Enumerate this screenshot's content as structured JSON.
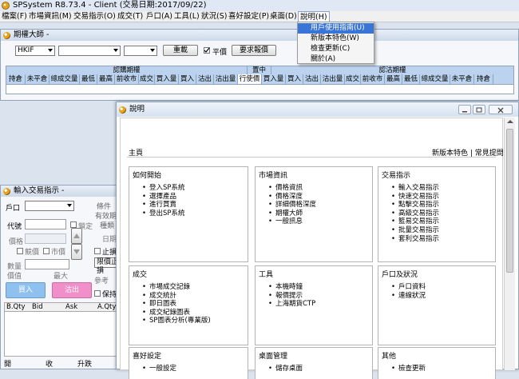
{
  "app": {
    "title": "SPSystem R8.73.4 - Client (交易日期:2017/09/22)"
  },
  "menubar": {
    "items": [
      "檔案(F)",
      "市場資訊(M)",
      "交易指示(O)",
      "成交(T)",
      "戶口(A)",
      "工具(L)",
      "狀況(S)",
      "喜好設定(P)",
      "桌面(D)",
      "說明(H)"
    ]
  },
  "help_menu": {
    "items": [
      "用戶使用指南(U)",
      "新版本特色(W)",
      "檢查更新(C)",
      "關於(A)"
    ],
    "highlighted_index": 0
  },
  "options_window": {
    "title": "期權大師 -",
    "product": "HKIF",
    "combo2": "",
    "combo3": "",
    "reload_label": "重載",
    "parity_label": "平價",
    "parity_checked": true,
    "request_quote_label": "要求報價",
    "group_calls": "認購期權",
    "group_strike": "置中",
    "group_puts": "認沽期權",
    "columns": [
      "持倉",
      "未平倉",
      "總成交量",
      "最低",
      "最高",
      "前收市",
      "成交",
      "買入量",
      "買入",
      "沽出",
      "沽出量",
      "行使價",
      "買入量",
      "買入",
      "沽出",
      "沽出量",
      "成交",
      "前收市",
      "最高",
      "最低",
      "總成交量",
      "未平倉",
      "持倉"
    ]
  },
  "order_window": {
    "title": "輸入交易指示 -",
    "account_label": "戶口",
    "code_label": "代號",
    "lock_label": "鎖定",
    "price_label": "價格",
    "ao_label": "競價",
    "market_label": "市價",
    "qty_label": "數量",
    "value_label": "價值",
    "max_label": "最大",
    "condition_label": "條件",
    "validity_label": "有效期",
    "type_label": "種類",
    "date_label": "日期",
    "stop_label": "止損",
    "limit_label": "限價止損",
    "ref_label": "參考",
    "keep_label": "保持",
    "buy_label": "買入",
    "sell_label": "沽出",
    "grid_headers": [
      "B.Qty",
      "Bid",
      "Ask",
      "A.Qty"
    ],
    "bottom_labels": [
      "開",
      "收",
      "升跌"
    ]
  },
  "help_window": {
    "title": "說明",
    "home_label": "主頁",
    "links": "新版本特色 | 常見提問",
    "sections": [
      {
        "title": "如何開始",
        "items": [
          "登入SP系統",
          "選擇產品",
          "進行買賣",
          "登出SP系統"
        ]
      },
      {
        "title": "市場資訊",
        "items": [
          "價格資訊",
          "價格深度",
          "詳細價格深度",
          "期權大師",
          "一般訊息"
        ]
      },
      {
        "title": "交易指示",
        "items": [
          "輸入交易指示",
          "快速交易指示",
          "點擊交易指示",
          "高級交易指示",
          "籃易交易指示",
          "批量交易指示",
          "套利交易指示"
        ]
      },
      {
        "title": "成交",
        "items": [
          "市場成交記錄",
          "成交統計",
          "即日圖表",
          "成交紀錄圖表",
          "SP圖表分析(專業版)"
        ]
      },
      {
        "title": "工具",
        "items": [
          "本機時鐘",
          "報價提示",
          "上海期貨CTP"
        ]
      },
      {
        "title": "戶口及狀況",
        "items": [
          "戶口資料",
          "連線狀況"
        ]
      },
      {
        "title": "喜好設定",
        "items": [
          "一般設定"
        ]
      },
      {
        "title": "桌面管理",
        "items": [
          "儲存桌面"
        ]
      },
      {
        "title": "其他",
        "items": [
          "檢查更新"
        ]
      }
    ]
  },
  "colors": {
    "accent": "#3875d7",
    "buy_button": "#8fc1f0",
    "sell_button": "#f08fc9",
    "header_blue": "#bcd3ef"
  }
}
